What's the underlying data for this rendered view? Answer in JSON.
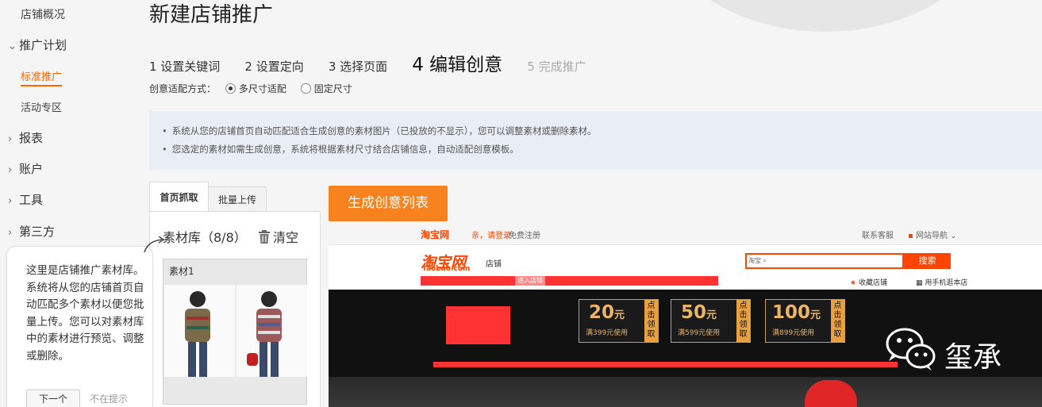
{
  "sidebar": {
    "overview": "店铺概况",
    "plan": "推广计划",
    "standard": "标准推广",
    "activity": "活动专区",
    "report": "报表",
    "account": "账户",
    "tools": "工具",
    "third": "第三方"
  },
  "tooltip": {
    "text": "这里是店铺推广素材库。系统将从您的店铺首页自动匹配多个素材以便您批量上传。您可以对素材库中的素材进行预览、调整或删除。",
    "next": "下一个",
    "skip": "不在提示"
  },
  "page": {
    "title": "新建店铺推广",
    "steps": [
      "1 设置关键词",
      "2 设置定向",
      "3 选择页面",
      "4 编辑创意",
      "5 完成推广"
    ],
    "fit_label": "创意适配方式：",
    "fit_options": [
      "多尺寸适配",
      "固定尺寸"
    ],
    "notice": [
      "系统从您的店铺首页自动匹配适合生成创意的素材图片（已投放的不显示），您可以调整素材或删除素材。",
      "您选定的素材如需生成创意，系统将根据素材尺寸结合店铺信息，自动适配创意模板。"
    ]
  },
  "library": {
    "tabs": [
      "首页抓取",
      "批量上传"
    ],
    "title": "素材库（8/8）",
    "clear": "清空",
    "material_label": "素材1"
  },
  "generate_button": "生成创意列表",
  "preview": {
    "topbar_logo": "淘宝网",
    "hello": "亲，请登录",
    "register": "免费注册",
    "service": "联系客服",
    "site_nav": "网站导航",
    "logo": "淘宝网",
    "logo_en": "Taobao.com",
    "shop": "店铺",
    "search_scope": "淘宝",
    "search_button": "搜索",
    "enter_shop": "进入店铺",
    "fav_shop": "收藏店铺",
    "mobile_shop": "用手机逛本店",
    "coupons": [
      {
        "amount": "20",
        "unit": "元",
        "condition": "满399元使用",
        "get": "点击领取"
      },
      {
        "amount": "50",
        "unit": "元",
        "condition": "满599元使用",
        "get": "点击领取"
      },
      {
        "amount": "100",
        "unit": "元",
        "condition": "满899元使用",
        "get": "点击领取"
      }
    ]
  },
  "watermark": {
    "name": "玺承"
  }
}
